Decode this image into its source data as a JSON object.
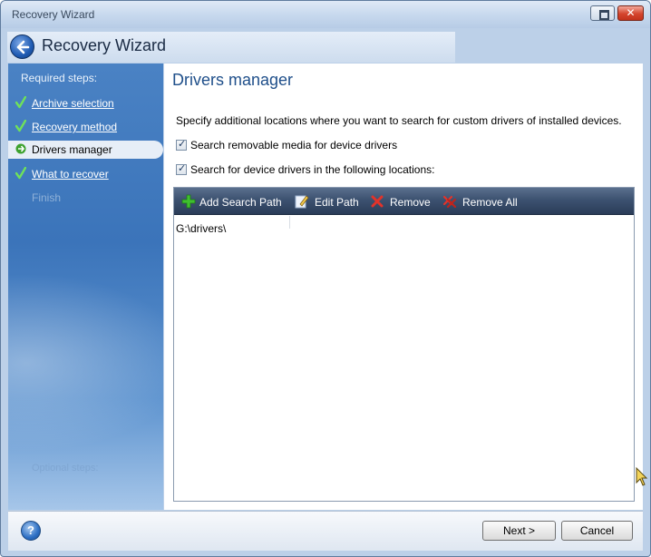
{
  "window": {
    "title": "Recovery Wizard",
    "close_glyph": "✕"
  },
  "header": {
    "title": "Recovery Wizard"
  },
  "sidebar": {
    "heading": "Required steps:",
    "steps": [
      {
        "label": "Archive selection",
        "state": "done"
      },
      {
        "label": "Recovery method",
        "state": "done"
      },
      {
        "label": "Drivers manager",
        "state": "current"
      },
      {
        "label": "What to recover",
        "state": "done"
      },
      {
        "label": "Finish",
        "state": "pending"
      }
    ],
    "faded_text": "Optional steps:"
  },
  "main": {
    "title": "Drivers manager",
    "description": "Specify additional locations where you want to search for custom drivers of installed devices.",
    "checkbox_removable": {
      "label": "Search removable media for device drivers",
      "checked": true
    },
    "checkbox_locations": {
      "label": "Search for device drivers in the following locations:",
      "checked": true
    },
    "toolbar": {
      "add": "Add Search Path",
      "edit": "Edit Path",
      "remove": "Remove",
      "remove_all": "Remove All"
    },
    "paths": [
      "G:\\drivers\\"
    ]
  },
  "footer": {
    "help_glyph": "?",
    "next": "Next >",
    "cancel": "Cancel"
  },
  "colors": {
    "accent": "#1f4f8a",
    "sidebar": "#3b74ba",
    "toolbar": "#3d5271"
  }
}
